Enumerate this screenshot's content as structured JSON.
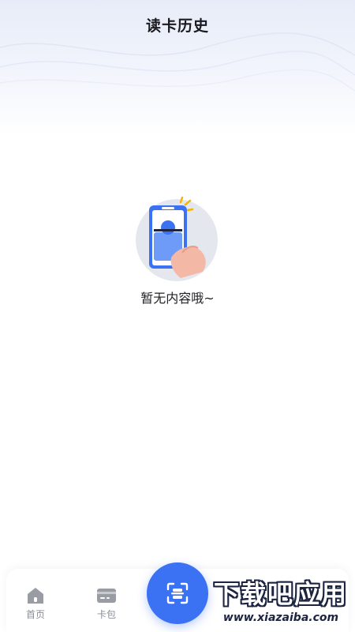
{
  "header": {
    "title": "读卡历史"
  },
  "empty_state": {
    "illustration_icon": "phone-scan-card-icon",
    "message": "暂无内容哦~"
  },
  "tabbar": {
    "tabs": [
      {
        "label": "首页",
        "icon": "home-icon"
      },
      {
        "label": "卡包",
        "icon": "card-wallet-icon"
      },
      {
        "label": "",
        "icon": "scan-icon"
      },
      {
        "label": "",
        "icon": "history-icon"
      },
      {
        "label": "",
        "icon": "user-icon"
      }
    ],
    "scan_icon": "scan-icon"
  },
  "watermark": {
    "main": "下载吧应用",
    "sub": "www.xiazaiba.com"
  },
  "colors": {
    "accent": "#3a72f3",
    "tab_icon": "#9a9ca4",
    "tab_label": "#8a8d96",
    "title": "#1b1b1f"
  }
}
